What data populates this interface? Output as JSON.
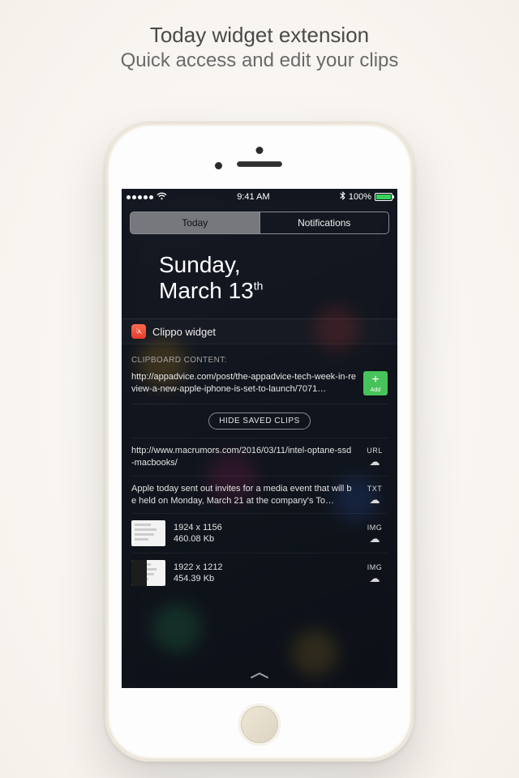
{
  "promo": {
    "title": "Today widget extension",
    "subtitle": "Quick access and edit your clips"
  },
  "status": {
    "time": "9:41 AM",
    "battery": "100%"
  },
  "tabs": {
    "today": "Today",
    "notifications": "Notifications"
  },
  "date": {
    "weekday": "Sunday,",
    "month_day": "March 13",
    "ordinal": "th"
  },
  "widget": {
    "title": "Clippo widget",
    "section_label": "CLIPBOARD CONTENT:",
    "current_clip": "http://appadvice.com/post/the-appadvice-tech-week-in-review-a-new-apple-iphone-is-set-to-launch/7071…",
    "add_label": "Add",
    "hide_button": "HIDE SAVED CLIPS",
    "clips": [
      {
        "text": "http://www.macrumors.com/2016/03/11/intel-optane-ssd-macbooks/",
        "type": "URL"
      },
      {
        "text": "Apple today sent out invites for a media event that will be held on Monday, March 21 at the company's To…",
        "type": "TXT"
      },
      {
        "dims": "1924 x 1156",
        "size": "460.08 Kb",
        "type": "IMG"
      },
      {
        "dims": "1922 x 1212",
        "size": "454.39 Kb",
        "type": "IMG"
      }
    ]
  }
}
